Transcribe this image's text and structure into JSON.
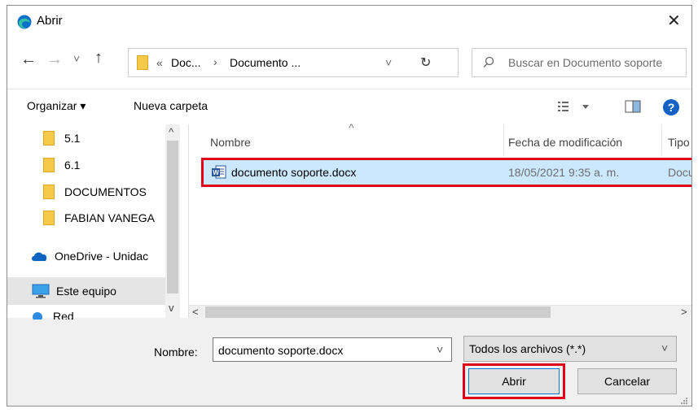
{
  "window": {
    "title": "Abrir",
    "close": "✕"
  },
  "nav": {
    "back": "←",
    "forward": "→",
    "dropdown": "˅",
    "up": "↑"
  },
  "address": {
    "crumbs_prefix": "«",
    "crumb1": "Doc...",
    "sep": "›",
    "crumb2": "Documento ...",
    "dropdown": "˅",
    "refresh": "↻"
  },
  "search": {
    "placeholder": "Buscar en Documento soporte"
  },
  "toolbar": {
    "organize": "Organizar ▾",
    "new_folder": "Nueva carpeta",
    "help": "?"
  },
  "sidebar": {
    "items": [
      {
        "label": "5.1"
      },
      {
        "label": "6.1"
      },
      {
        "label": "DOCUMENTOS"
      },
      {
        "label": "FABIAN VANEGA"
      },
      {
        "label": "OneDrive - Unidac"
      },
      {
        "label": "Este equipo"
      },
      {
        "label": "Red"
      }
    ]
  },
  "columns": {
    "name": "Nombre",
    "date": "Fecha de modificación",
    "type": "Tipo"
  },
  "files": [
    {
      "name": "documento soporte.docx",
      "date": "18/05/2021 9:35 a. m.",
      "type": "Docu"
    }
  ],
  "scroll": {
    "left": "<",
    "right": ">",
    "up": "^",
    "down": "v"
  },
  "footer": {
    "filename_label": "Nombre:",
    "filename_value": "documento soporte.docx",
    "filetype": "Todos los archivos (*.*)",
    "open": "Abrir",
    "cancel": "Cancelar"
  },
  "colors": {
    "selection": "#cce8ff",
    "highlight": "#e0001a",
    "accent": "#0078d7"
  }
}
